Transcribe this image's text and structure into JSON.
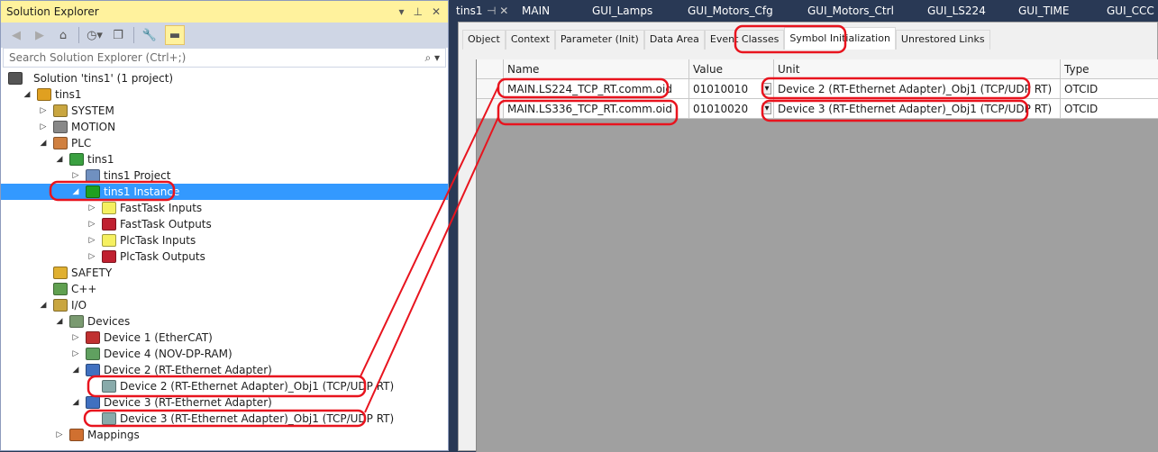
{
  "solution_explorer": {
    "title": "Solution Explorer",
    "search_placeholder": "Search Solution Explorer (Ctrl+;)",
    "tree": [
      {
        "label": "Solution 'tins1' (1 project)",
        "level": 0,
        "arrow": "",
        "icon": "solution-icon",
        "color": "#555"
      },
      {
        "label": "tins1",
        "level": 1,
        "arrow": "expanded",
        "icon": "project-icon",
        "color": "#e0a020"
      },
      {
        "label": "SYSTEM",
        "level": 2,
        "arrow": "collapsed",
        "icon": "system-icon",
        "color": "#c9a640"
      },
      {
        "label": "MOTION",
        "level": 2,
        "arrow": "collapsed",
        "icon": "motion-icon",
        "color": "#888"
      },
      {
        "label": "PLC",
        "level": 2,
        "arrow": "expanded",
        "icon": "plc-icon",
        "color": "#d08040"
      },
      {
        "label": "tins1",
        "level": 3,
        "arrow": "expanded",
        "icon": "plc-project-icon",
        "color": "#3aa040"
      },
      {
        "label": "tins1 Project",
        "level": 4,
        "arrow": "collapsed",
        "icon": "plc-project-file-icon",
        "color": "#7090c0"
      },
      {
        "label": "tins1 Instance",
        "level": 4,
        "arrow": "expanded",
        "icon": "instance-icon",
        "color": "#20a020",
        "selected": true
      },
      {
        "label": "FastTask Inputs",
        "level": 5,
        "arrow": "collapsed",
        "icon": "inputs-icon",
        "color": "#f5f060"
      },
      {
        "label": "FastTask Outputs",
        "level": 5,
        "arrow": "collapsed",
        "icon": "outputs-icon",
        "color": "#c02030"
      },
      {
        "label": "PlcTask Inputs",
        "level": 5,
        "arrow": "collapsed",
        "icon": "inputs-icon",
        "color": "#f5f060"
      },
      {
        "label": "PlcTask Outputs",
        "level": 5,
        "arrow": "collapsed",
        "icon": "outputs-icon",
        "color": "#c02030"
      },
      {
        "label": "SAFETY",
        "level": 2,
        "arrow": "",
        "icon": "safety-icon",
        "color": "#e0b030"
      },
      {
        "label": "C++",
        "level": 2,
        "arrow": "",
        "icon": "cpp-icon",
        "color": "#60a050"
      },
      {
        "label": "I/O",
        "level": 2,
        "arrow": "expanded",
        "icon": "io-icon",
        "color": "#c9a640"
      },
      {
        "label": "Devices",
        "level": 3,
        "arrow": "expanded",
        "icon": "devices-icon",
        "color": "#7a9a70"
      },
      {
        "label": "Device 1 (EtherCAT)",
        "level": 4,
        "arrow": "collapsed",
        "icon": "ethercat-icon",
        "color": "#c03030"
      },
      {
        "label": "Device 4 (NOV-DP-RAM)",
        "level": 4,
        "arrow": "collapsed",
        "icon": "card-icon",
        "color": "#60a060"
      },
      {
        "label": "Device 2 (RT-Ethernet Adapter)",
        "level": 4,
        "arrow": "expanded",
        "icon": "network-icon",
        "color": "#4070c0"
      },
      {
        "label": "Device 2 (RT-Ethernet Adapter)_Obj1 (TCP/UDP RT)",
        "level": 5,
        "arrow": "",
        "icon": "object-icon",
        "color": "#8aa"
      },
      {
        "label": "Device 3 (RT-Ethernet Adapter)",
        "level": 4,
        "arrow": "expanded",
        "icon": "network-icon",
        "color": "#4070c0"
      },
      {
        "label": "Device 3 (RT-Ethernet Adapter)_Obj1 (TCP/UDP RT)",
        "level": 5,
        "arrow": "",
        "icon": "object-icon",
        "color": "#8aa"
      },
      {
        "label": "Mappings",
        "level": 3,
        "arrow": "collapsed",
        "icon": "mappings-icon",
        "color": "#d07030"
      }
    ]
  },
  "doc_tabs": [
    "tins1",
    "MAIN",
    "GUI_Lamps",
    "GUI_Motors_Cfg",
    "GUI_Motors_Ctrl",
    "GUI_LS224",
    "GUI_TIME",
    "GUI_CCC"
  ],
  "prop_tabs": [
    "Object",
    "Context",
    "Parameter (Init)",
    "Data Area",
    "Event Classes",
    "Symbol Initialization",
    "Unrestored Links"
  ],
  "active_prop_tab": "Symbol Initialization",
  "grid": {
    "columns": [
      "Name",
      "Value",
      "Unit",
      "Type"
    ],
    "rows": [
      {
        "name": "MAIN.LS224_TCP_RT.comm.oid",
        "value": "01010010",
        "unit": "Device 2 (RT-Ethernet Adapter)_Obj1 (TCP/UDP RT)",
        "type": "OTCID"
      },
      {
        "name": "MAIN.LS336_TCP_RT.comm.oid",
        "value": "01010020",
        "unit": "Device 3 (RT-Ethernet Adapter)_Obj1 (TCP/UDP RT)",
        "type": "OTCID"
      }
    ]
  },
  "annotation_color": "#e8141e"
}
